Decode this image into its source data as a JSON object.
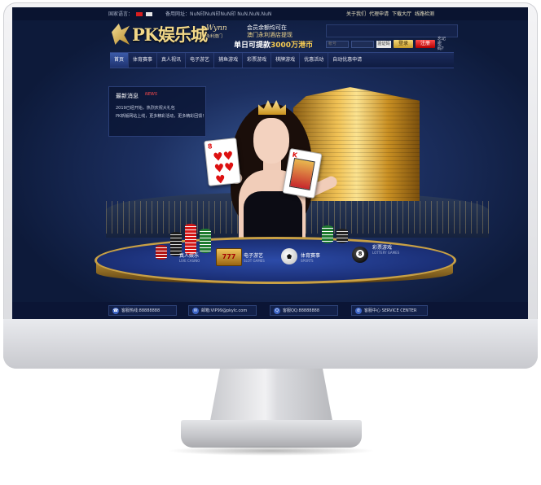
{
  "topbar": {
    "language_label": "国家语言：",
    "alt_urls": "备用网址：NuN印NuN印NuN印 NuN.NuN.NuN",
    "links": [
      "关于我们",
      "代理申请",
      "下载大厅",
      "线路检测"
    ]
  },
  "header": {
    "logo_text": "PK娱乐城",
    "promo": {
      "brand": "Wynn",
      "brand_sub": "永利澳门",
      "line1": "会员余额均可在",
      "line2": "澳门永利酒店提现",
      "line3_prefix": "单日可提款",
      "line3_amount": "3000万港币"
    }
  },
  "login": {
    "account_placeholder": "帐号",
    "captcha": "验证码",
    "signin_label": "登录",
    "join_label": "注册",
    "forgot_label": "忘记密码？"
  },
  "nav": {
    "items": [
      {
        "label": "首页",
        "active": true
      },
      {
        "label": "体育赛事"
      },
      {
        "label": "真人视讯"
      },
      {
        "label": "电子游艺"
      },
      {
        "label": "捕鱼游戏"
      },
      {
        "label": "彩票游戏"
      },
      {
        "label": "棋牌游戏"
      },
      {
        "label": "优惠活动"
      },
      {
        "label": "自动优惠申请"
      }
    ]
  },
  "news": {
    "title": "最新消息",
    "tag": "NEWS",
    "lines": [
      "2019已经开始，热烈庆祝大礼包",
      "PK新版网站上线，更多精彩活动，更多精彩回馈！"
    ]
  },
  "hero": {
    "card_left_rank": "8",
    "card_right_rank": "K",
    "slot_text": "777",
    "eight_ball_text": "8"
  },
  "categories": [
    {
      "label": "真人娱乐",
      "sub": "LIVE CASINO"
    },
    {
      "label": "电子游艺",
      "sub": "SLOT GAMES"
    },
    {
      "label": "体育赛事",
      "sub": "SPORTS"
    },
    {
      "label": "彩票游戏",
      "sub": "LOTTERY GAMES"
    }
  ],
  "footer": {
    "contacts": [
      {
        "icon": "phone-icon",
        "text": "客服热线:88888888"
      },
      {
        "icon": "mail-icon",
        "text": "邮箱:VIP99@pkylc.com"
      },
      {
        "icon": "qq-icon",
        "text": "客服QQ:88888888"
      },
      {
        "icon": "service-icon",
        "text": "客服中心 SERVICE CENTER"
      }
    ]
  },
  "colors": {
    "gold": "#f1d788",
    "navy": "#0d1a3a",
    "signin": "#e0b23e",
    "join": "#d10000"
  }
}
